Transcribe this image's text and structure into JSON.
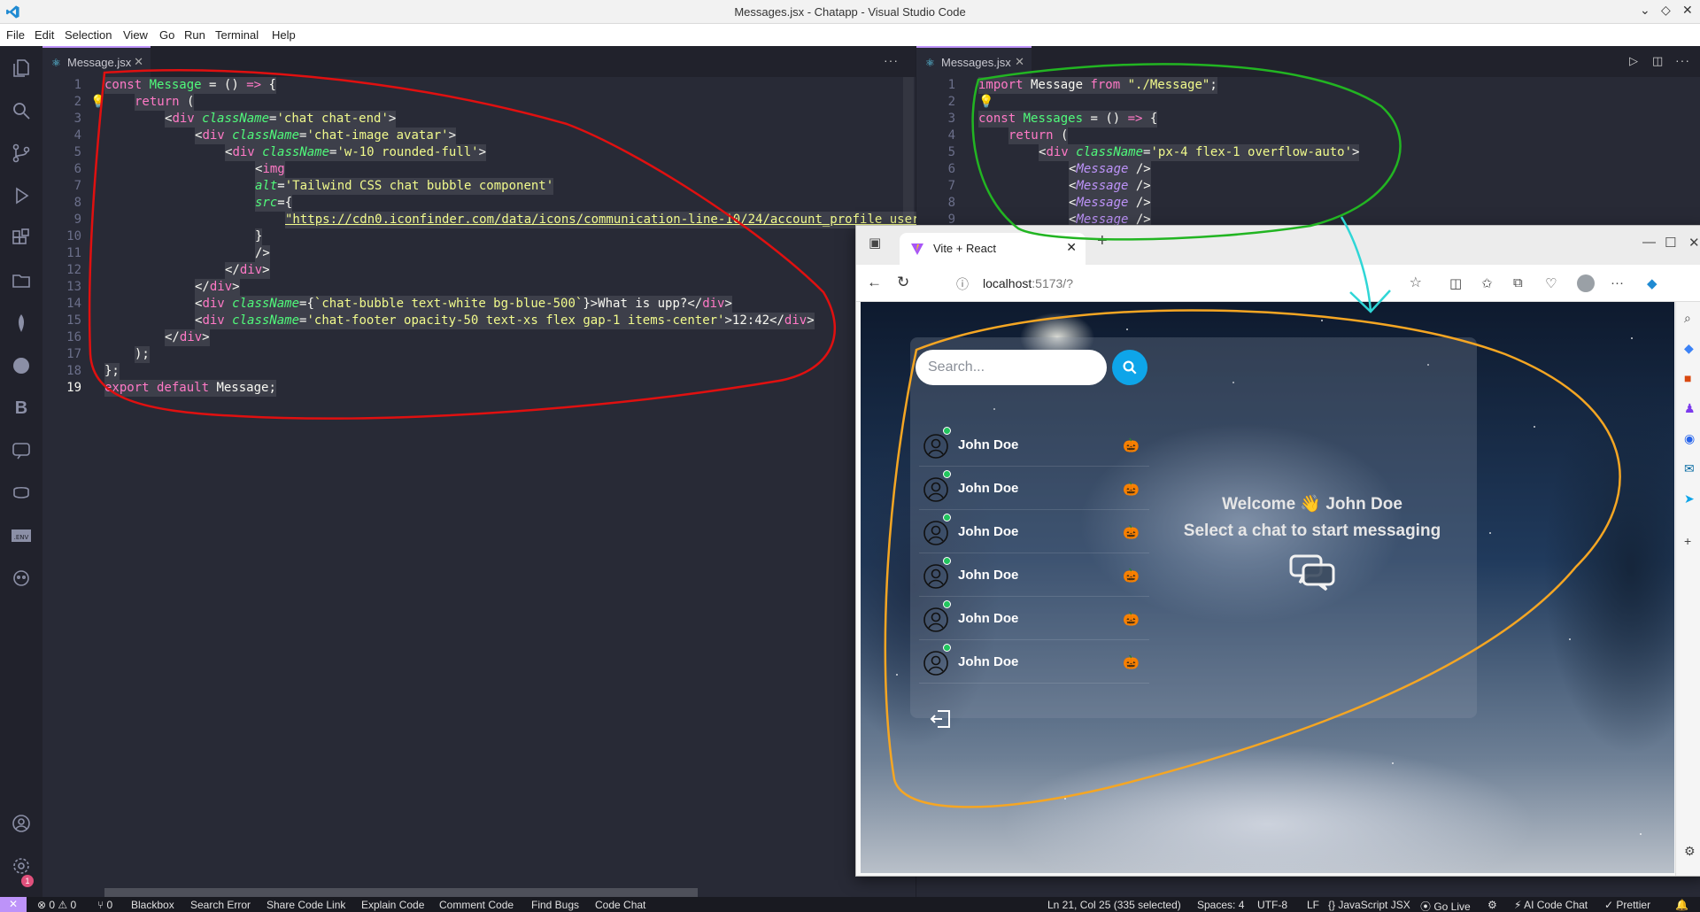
{
  "window": {
    "title": "Messages.jsx - Chatapp - Visual Studio Code"
  },
  "menu": [
    "File",
    "Edit",
    "Selection",
    "View",
    "Go",
    "Run",
    "Terminal",
    "Help"
  ],
  "left_editor": {
    "tab_label": "Message.jsx",
    "lines": [
      {
        "n": "1"
      },
      {
        "n": "2"
      },
      {
        "n": "3"
      },
      {
        "n": "4"
      },
      {
        "n": "5"
      },
      {
        "n": "6"
      },
      {
        "n": "7"
      },
      {
        "n": "8"
      },
      {
        "n": "9"
      },
      {
        "n": "10"
      },
      {
        "n": "11"
      },
      {
        "n": "12"
      },
      {
        "n": "13"
      },
      {
        "n": "14"
      },
      {
        "n": "15"
      },
      {
        "n": "16"
      },
      {
        "n": "17"
      },
      {
        "n": "18"
      },
      {
        "n": "19"
      }
    ],
    "code": {
      "l1": "const Message = () => {",
      "l2": "return (",
      "l3": "<div className='chat chat-end'>",
      "l4": "<div className='chat-image avatar'>",
      "l5": "<div className='w-10 rounded-full'>",
      "l6": "<img",
      "l7": "alt='Tailwind CSS chat bubble component'",
      "l8": "src={",
      "l9": "\"https://cdn0.iconfinder.com/data/icons/communication-line-10/24/account_profile_user",
      "l10": "}",
      "l11": "/>",
      "l12": "</div>",
      "l13": "</div>",
      "l14": "<div className={`chat-bubble text-white bg-blue-500`}>What is upp?</div>",
      "l15": "<div className='chat-footer opacity-50 text-xs flex gap-1 items-center'>12:42</div>",
      "l16": "</div>",
      "l17": ");",
      "l18": "};",
      "l19": "export default Message;"
    }
  },
  "right_editor": {
    "tab_label": "Messages.jsx",
    "lines": [
      {
        "n": "1"
      },
      {
        "n": "2"
      },
      {
        "n": "3"
      },
      {
        "n": "4"
      },
      {
        "n": "5"
      },
      {
        "n": "6"
      },
      {
        "n": "7"
      },
      {
        "n": "8"
      },
      {
        "n": "9"
      }
    ],
    "code": {
      "l1": "import Message from \"./Message\";",
      "l3": "const Messages = () => {",
      "l4": "return (",
      "l5": "<div className='px-4 flex-1 overflow-auto'>",
      "l6": "<Message />",
      "l7": "<Message />",
      "l8": "<Message />",
      "l9": "<Message />"
    }
  },
  "browser": {
    "tab_title": "Vite + React",
    "url_host": "localhost",
    "url_rest": ":5173/?",
    "search_placeholder": "Search...",
    "conversations": [
      {
        "name": "John Doe",
        "emoji": "🎃"
      },
      {
        "name": "John Doe",
        "emoji": "🎃"
      },
      {
        "name": "John Doe",
        "emoji": "🎃"
      },
      {
        "name": "John Doe",
        "emoji": "🎃"
      },
      {
        "name": "John Doe",
        "emoji": "🎃"
      },
      {
        "name": "John Doe",
        "emoji": "🎃"
      }
    ],
    "welcome_line1": "Welcome 👋 John Doe",
    "welcome_line2": "Select a chat to start messaging"
  },
  "statusbar": {
    "problems": "⊗ 0 ⚠ 0",
    "ports": "⑂ 0",
    "items": [
      "Blackbox",
      "Search Error",
      "Share Code Link",
      "Explain Code",
      "Comment Code",
      "Find Bugs",
      "Code Chat"
    ],
    "cursor": "Ln 21, Col 25 (335 selected)",
    "spaces": "Spaces: 4",
    "encoding": "UTF-8",
    "eol": "LF",
    "language": "{} JavaScript JSX",
    "golive": "⦿ Go Live",
    "ai": "⚡ AI Code Chat",
    "prettier": "✓ Prettier"
  },
  "colors": {
    "accent": "#bd93f9",
    "annotation_red": "#e01010",
    "annotation_green": "#22b522",
    "annotation_cyan": "#2fd6d6",
    "annotation_orange": "#f5a623",
    "search_button": "#0ea5e9",
    "online_dot": "#22c55e"
  },
  "icons": {
    "activity": [
      "files-icon",
      "search-icon",
      "source-control-icon",
      "run-debug-icon",
      "extensions-icon",
      "folder-icon",
      "leaf-icon",
      "graph-icon",
      "blackbox-icon",
      "chat-icon",
      "copilot-icon",
      "env-icon",
      "bot-icon",
      "account-icon",
      "settings-icon"
    ]
  }
}
